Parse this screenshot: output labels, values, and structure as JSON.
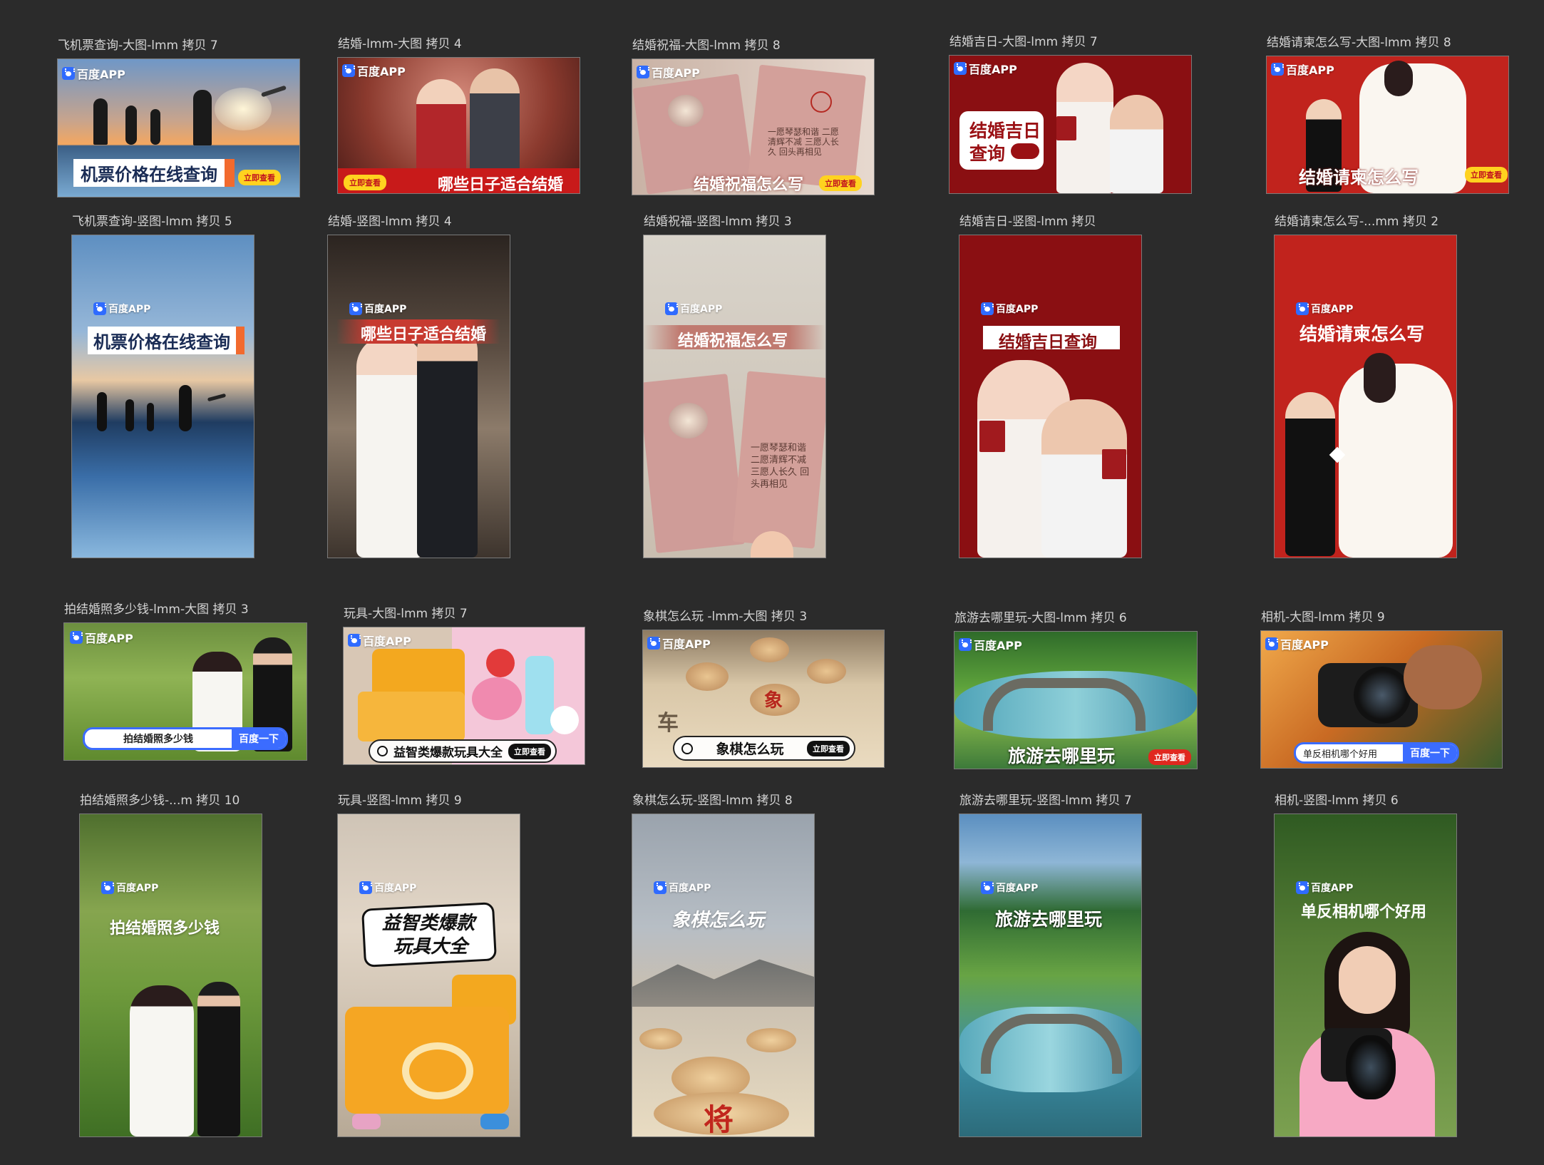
{
  "brand": {
    "logo_text": "百度APP",
    "accent": "#2f6bff"
  },
  "row1": [
    {
      "label": "飞机票查询-大图-lmm 拷贝 7",
      "headline": "机票价格在线查询",
      "cta": "立即查看"
    },
    {
      "label": "结婚-lmm-大图 拷贝 4",
      "headline": "哪些日子适合结婚",
      "cta": "立即查看"
    },
    {
      "label": "结婚祝福-大图-lmm 拷贝 8",
      "headline": "结婚祝福怎么写",
      "cta": "立即查看"
    },
    {
      "label": "结婚吉日-大图-lmm 拷贝 7",
      "headline_line1": "结婚吉日",
      "headline_line2": "查询"
    },
    {
      "label": "结婚请柬怎么写-大图-lmm 拷贝 8",
      "headline": "结婚请柬怎么写",
      "cta": "立即查看"
    }
  ],
  "row2": [
    {
      "label": "飞机票查询-竖图-lmm 拷贝 5",
      "headline": "机票价格在线查询"
    },
    {
      "label": "结婚-竖图-lmm 拷贝 4",
      "headline": "哪些日子适合结婚"
    },
    {
      "label": "结婚祝福-竖图-lmm 拷贝 3",
      "headline": "结婚祝福怎么写"
    },
    {
      "label": "结婚吉日-竖图-lmm 拷贝",
      "headline": "结婚吉日查询"
    },
    {
      "label": "结婚请柬怎么写-...mm 拷贝 2",
      "headline": "结婚请柬怎么写"
    }
  ],
  "row3": [
    {
      "label": "拍结婚照多少钱-lmm-大图 拷贝 3",
      "search_text": "拍结婚照多少钱",
      "search_button": "百度一下"
    },
    {
      "label": "玩具-大图-lmm 拷贝 7",
      "headline": "益智类爆款玩具大全",
      "cta": "立即查看"
    },
    {
      "label": "象棋怎么玩 -lmm-大图 拷贝 3",
      "headline": "象棋怎么玩",
      "cta": "立即查看"
    },
    {
      "label": "旅游去哪里玩-大图-lmm 拷贝 6",
      "headline": "旅游去哪里玩",
      "cta": "立即查看"
    },
    {
      "label": "相机-大图-lmm 拷贝 9",
      "search_text": "单反相机哪个好用",
      "search_button": "百度一下"
    }
  ],
  "row4": [
    {
      "label": "拍结婚照多少钱-...m 拷贝 10",
      "headline": "拍结婚照多少钱"
    },
    {
      "label": "玩具-竖图-lmm 拷贝 9",
      "headline_line1": "益智类爆款",
      "headline_line2": "玩具大全"
    },
    {
      "label": "象棋怎么玩-竖图-lmm 拷贝 8",
      "headline": "象棋怎么玩"
    },
    {
      "label": "旅游去哪里玩-竖图-lmm 拷贝 7",
      "headline": "旅游去哪里玩"
    },
    {
      "label": "相机-竖图-lmm 拷贝 6",
      "headline": "单反相机哪个好用"
    }
  ],
  "chess_glyphs": {
    "piece_a": "象",
    "piece_b": "车",
    "piece_c": "将"
  },
  "letter_text": "一愿琴瑟和谐 二愿清辉不减 三愿人长久 回头再相见"
}
